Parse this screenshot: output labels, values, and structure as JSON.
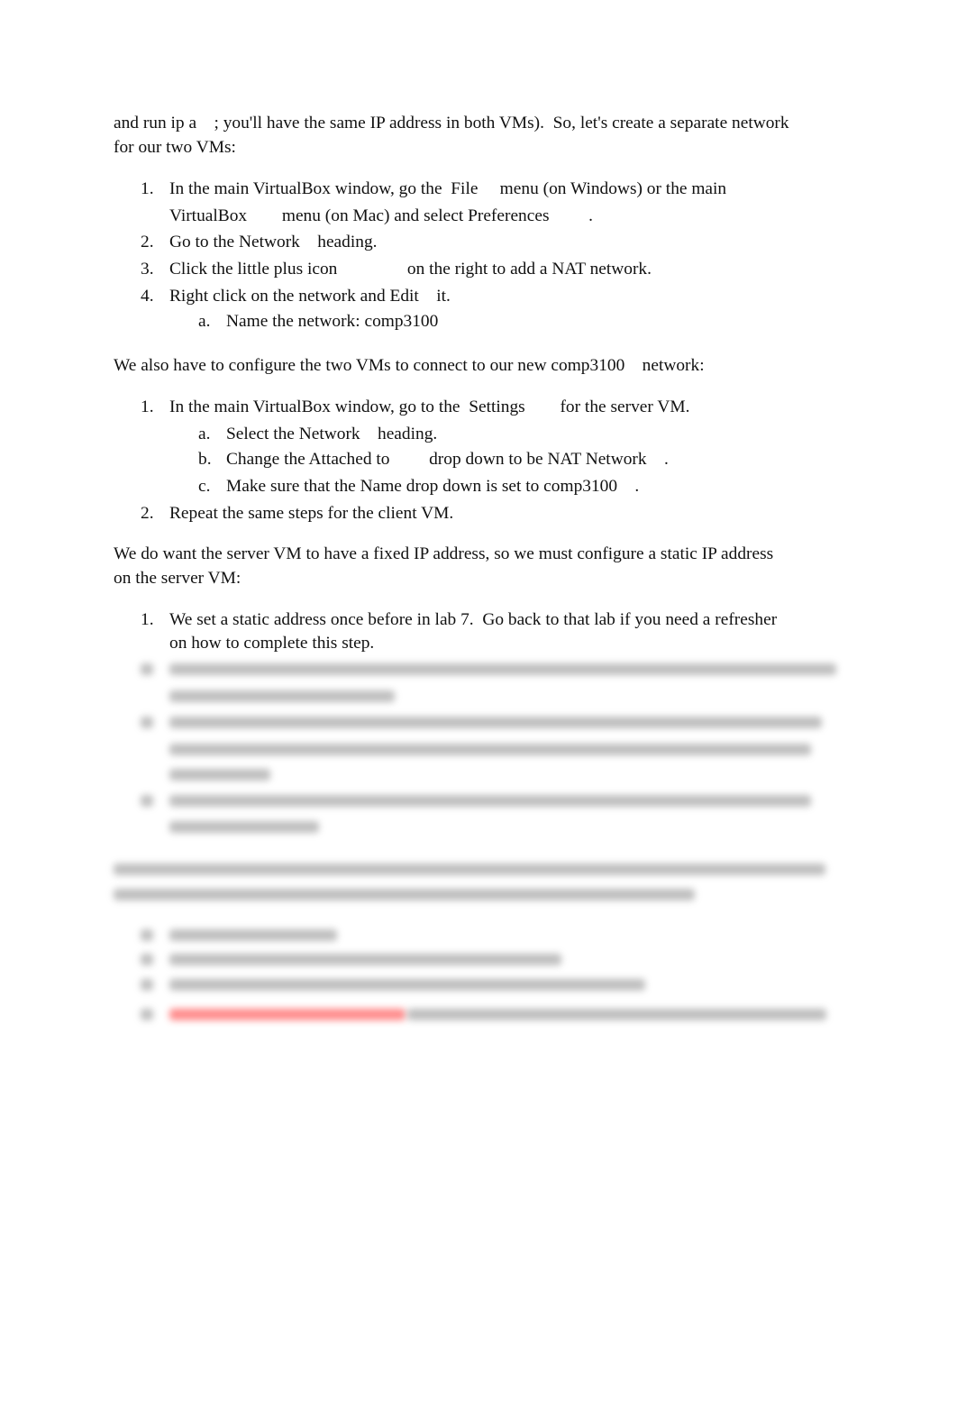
{
  "intro": {
    "line1": "and run ip a    ; you'll have the same IP address in both VMs).  So, let's create a separate network",
    "line2": "for our two VMs:"
  },
  "list1": [
    {
      "num": "1.",
      "lines": [
        "In the main VirtualBox window, go the  File     menu (on Windows) or the main",
        "VirtualBox        menu (on Mac) and select Preferences         ."
      ]
    },
    {
      "num": "2.",
      "lines": [
        "Go to the Network    heading."
      ]
    },
    {
      "num": "3.",
      "lines": [
        "Click the little plus icon                on the right to add a NAT network."
      ]
    },
    {
      "num": "4.",
      "lines": [
        "Right click on the network and Edit    it."
      ]
    },
    {
      "num": "a.",
      "lines": [
        "Name the network: comp3100"
      ]
    }
  ],
  "para2": "We also have to configure the two VMs to connect to our new comp3100    network:",
  "list2": [
    {
      "num": "1.",
      "lines": [
        "In the main VirtualBox window, go to the  Settings        for the server VM."
      ]
    },
    {
      "num": "a.",
      "lines": [
        "Select the Network    heading."
      ]
    },
    {
      "num": "b.",
      "lines": [
        "Change the Attached to         drop down to be NAT Network    ."
      ]
    },
    {
      "num": "c.",
      "lines": [
        "Make sure that the Name drop down is set to comp3100    ."
      ]
    },
    {
      "num": "2.",
      "lines": [
        "Repeat the same steps for the client VM."
      ]
    }
  ],
  "para3": {
    "line1": "We do want the server VM to have a fixed IP address, so we must configure a static IP address",
    "line2": "on the server VM:"
  },
  "list3": [
    {
      "num": "1.",
      "lines": [
        "We set a static address once before in lab 7.  Go back to that lab if you need a refresher",
        "on how to complete this step."
      ]
    }
  ],
  "colors": {
    "text": "#111111",
    "blurred_highlight": "#ff4040"
  }
}
